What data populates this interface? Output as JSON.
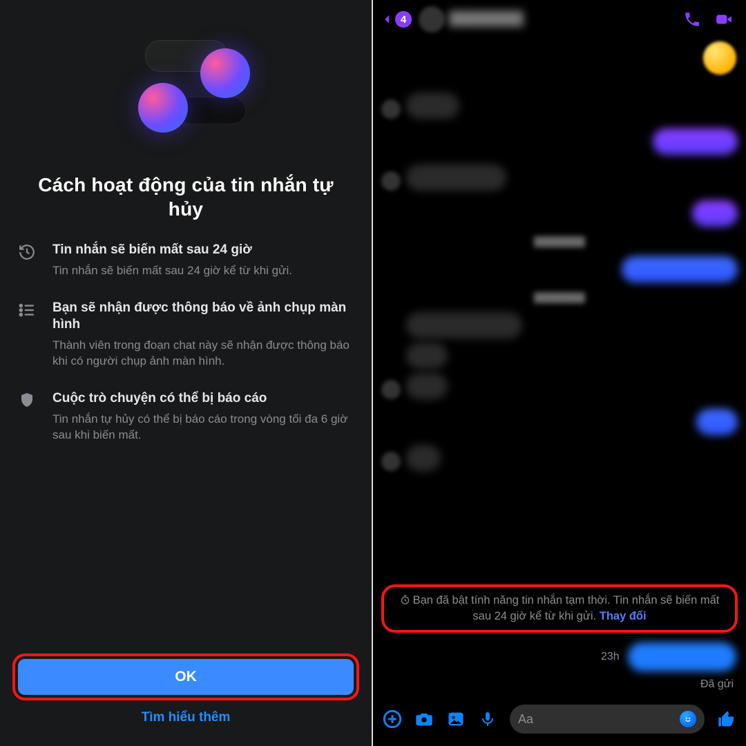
{
  "left": {
    "title": "Cách hoạt động của tin nhắn tự hủy",
    "features": [
      {
        "icon": "history",
        "title": "Tin nhắn sẽ biến mất sau 24 giờ",
        "desc": "Tin nhắn sẽ biến mất sau 24 giờ kể từ khi gửi."
      },
      {
        "icon": "list",
        "title": "Bạn sẽ nhận được thông báo về ảnh chụp màn hình",
        "desc": "Thành viên trong đoạn chat này sẽ nhận được thông báo khi có người chụp ảnh màn hình."
      },
      {
        "icon": "shield",
        "title": "Cuộc trò chuyện có thể bị báo cáo",
        "desc": "Tin nhắn tự hủy có thể bị báo cáo trong vòng tối đa 6 giờ sau khi biến mất."
      }
    ],
    "ok": "OK",
    "learn_more": "Tìm hiểu thêm"
  },
  "right": {
    "back_count": "4",
    "notice_text": "Bạn đã bật tính năng tin nhắn tạm thời. Tin nhắn sẽ biến mất sau 24 giờ kể từ khi gửi.",
    "notice_change": "Thay đổi",
    "last_time": "23h",
    "sent_label": "Đã gửi",
    "placeholder": "Aa"
  }
}
